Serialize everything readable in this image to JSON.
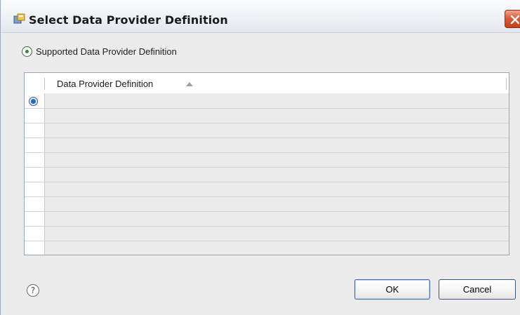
{
  "window": {
    "title": "Select Data Provider Definition"
  },
  "option": {
    "label": "Supported Data Provider Definition",
    "selected": true
  },
  "table": {
    "columns": [
      "Data Provider Definition"
    ],
    "sort_direction": "ascending",
    "rows": [
      {
        "selected": true,
        "value": ""
      }
    ],
    "empty_row_count": 10
  },
  "footer": {
    "ok_label": "OK",
    "cancel_label": "Cancel"
  },
  "colors": {
    "title_bar": "#eef1f5",
    "close_button": "#db5a38",
    "dialog_background": "#ececec",
    "selection_radio": "#2a67c7"
  },
  "icons": {
    "app": "data-provider-app-icon",
    "close": "close-icon",
    "help": "help-icon",
    "sort": "sort-ascending-icon"
  }
}
